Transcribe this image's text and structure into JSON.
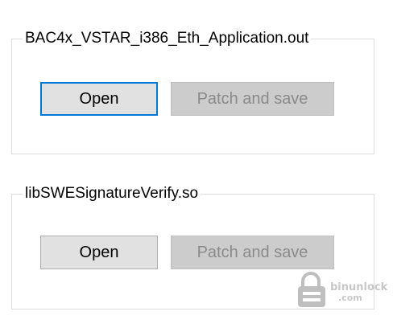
{
  "groups": [
    {
      "title": "BAC4x_VSTAR_i386_Eth_Application.out",
      "open_label": "Open",
      "patch_label": "Patch and save"
    },
    {
      "title": "libSWESignatureVerify.so",
      "open_label": "Open",
      "patch_label": "Patch and save"
    }
  ],
  "watermark": {
    "line1": "binunlock",
    "line2": ".com",
    "icon": "lock-icon"
  },
  "colors": {
    "focus_border": "#0078d7",
    "button_bg": "#e1e1e1",
    "disabled_bg": "#cccccc",
    "disabled_text": "#8a8a8a"
  }
}
